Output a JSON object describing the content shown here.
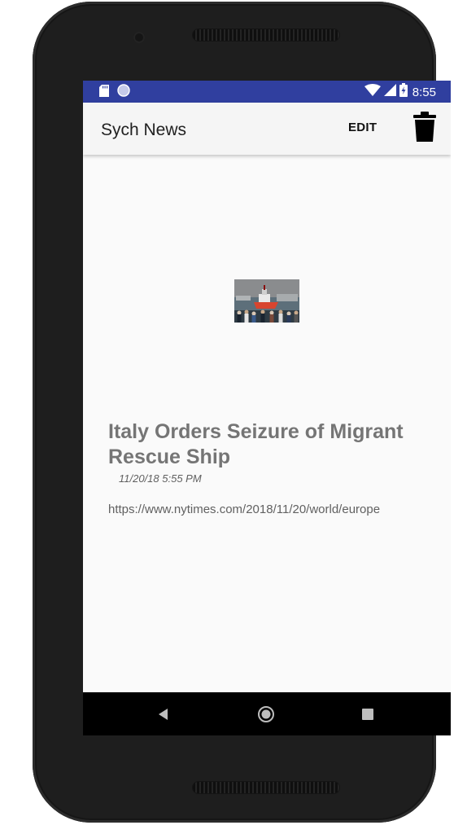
{
  "status_bar": {
    "time": "8:55",
    "icons": [
      "sd-card-icon",
      "sync-circle-icon",
      "wifi-icon",
      "cell-signal-icon",
      "battery-charging-icon"
    ]
  },
  "app_bar": {
    "title": "Sych News",
    "edit_label": "EDIT",
    "delete_icon": "trash-icon"
  },
  "article": {
    "image_alt": "Rescue ship in harbor with crowd",
    "headline": "Italy Orders Seizure of Migrant Rescue Ship",
    "date": "11/20/18 5:55 PM",
    "url": "https://www.nytimes.com/2018/11/20/world/europe"
  },
  "nav_bar": {
    "buttons": [
      "back-icon",
      "home-icon",
      "recents-icon"
    ]
  },
  "colors": {
    "status_bar": "#303f9f",
    "app_bar": "#f5f5f5",
    "background": "#fafafa",
    "headline": "#757575"
  }
}
